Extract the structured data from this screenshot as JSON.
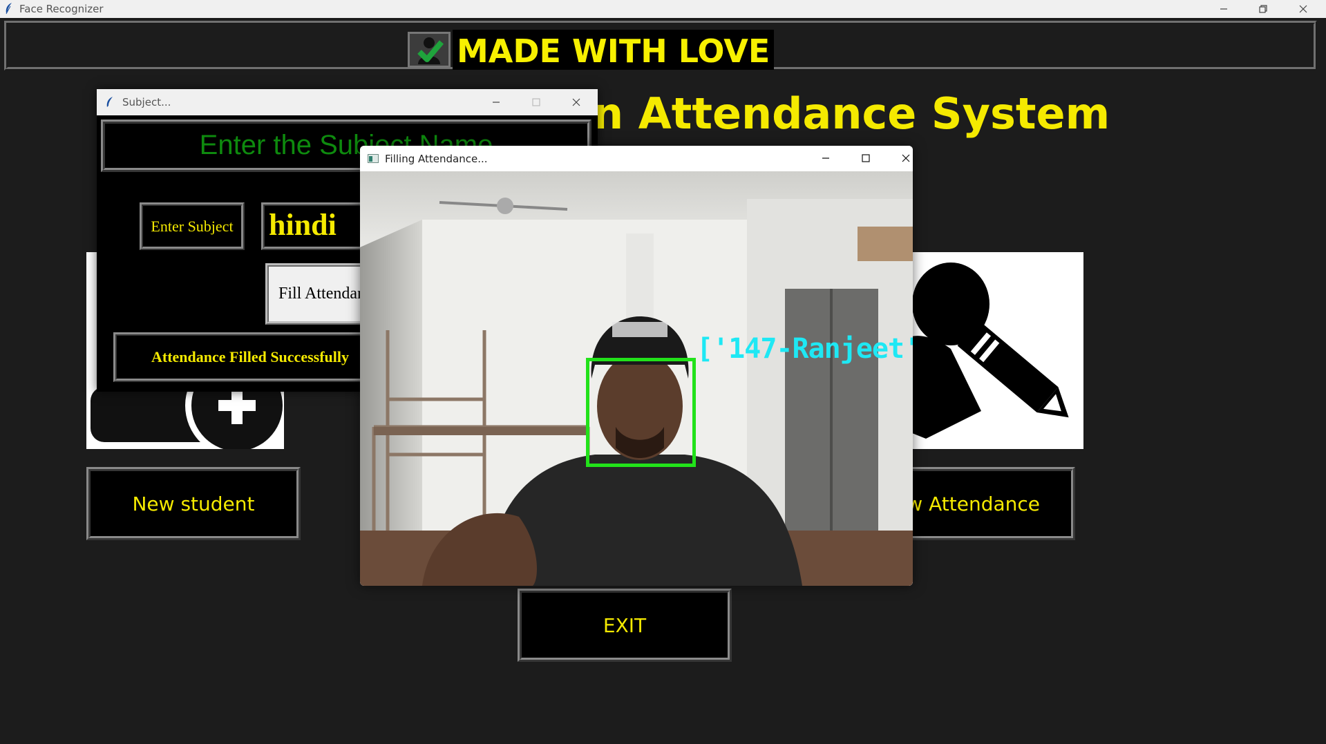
{
  "main_window": {
    "title": "Face Recognizer",
    "banner_text": "MADE WITH LOVE",
    "app_title": "n Attendance System",
    "buttons": {
      "new_student": "New student",
      "view_attendance": "ew Attendance",
      "exit": "EXIT"
    }
  },
  "subject_window": {
    "title": "Subject...",
    "header": "Enter the Subject Name",
    "enter_label": "Enter Subject",
    "subject_value": "hindi",
    "fill_button": "Fill Attendance",
    "status": "Attendance Filled Successfully"
  },
  "camera_window": {
    "title": "Filling Attendance...",
    "recognized_label": "['147-Ranjeet'"
  },
  "colors": {
    "accent_yellow": "#f5ea00",
    "header_green": "#0e8a0e",
    "face_box_green": "#22e21a",
    "name_cyan": "#1ee8f4"
  }
}
